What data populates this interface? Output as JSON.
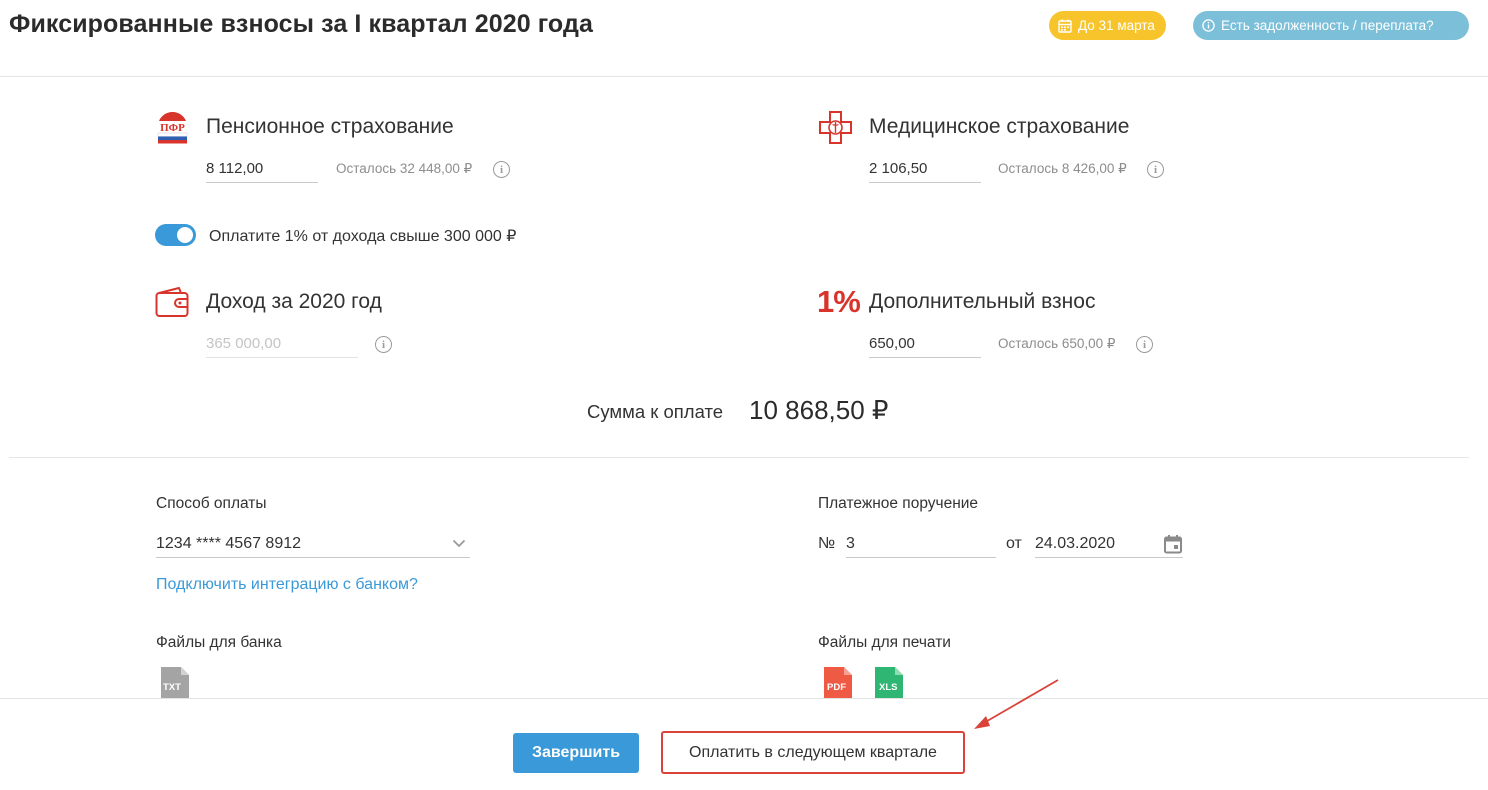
{
  "header": {
    "title": "Фиксированные взносы за I квартал 2020 года",
    "deadline_badge": "До 31 марта",
    "debt_badge": "Есть задолженность / переплата?"
  },
  "pension": {
    "title": "Пенсионное страхование",
    "value": "8 112,00",
    "remaining": "Осталось 32 448,00 ₽"
  },
  "medical": {
    "title": "Медицинское страхование",
    "value": "2 106,50",
    "remaining": "Осталось 8 426,00 ₽"
  },
  "toggle": {
    "label": "Оплатите 1% от дохода свыше 300 000 ₽",
    "on": true
  },
  "income": {
    "title": "Доход за 2020 год",
    "value": "365 000,00"
  },
  "additional": {
    "icon_text": "1%",
    "title": "Дополнительный взнос",
    "value": "650,00",
    "remaining": "Осталось 650,00 ₽"
  },
  "total": {
    "label": "Сумма к оплате",
    "value": "10 868,50 ₽"
  },
  "payment": {
    "method_label": "Способ оплаты",
    "method_value": "1234 **** 4567 8912",
    "bank_link": "Подключить интеграцию с банком?"
  },
  "order": {
    "label": "Платежное поручение",
    "number_prefix": "№",
    "number": "3",
    "date_prefix": "от",
    "date": "24.03.2020"
  },
  "bank_files": {
    "label": "Файлы для банка",
    "txt": "TXT"
  },
  "print_files": {
    "label": "Файлы для печати",
    "pdf": "PDF",
    "xls": "XLS"
  },
  "actions": {
    "finish": "Завершить",
    "pay_next_quarter": "Оплатить в следующем квартале"
  },
  "colors": {
    "accent": "#3a99d8",
    "warning": "#f7c52b",
    "info": "#7cbfd9",
    "highlight": "#d9433a"
  }
}
